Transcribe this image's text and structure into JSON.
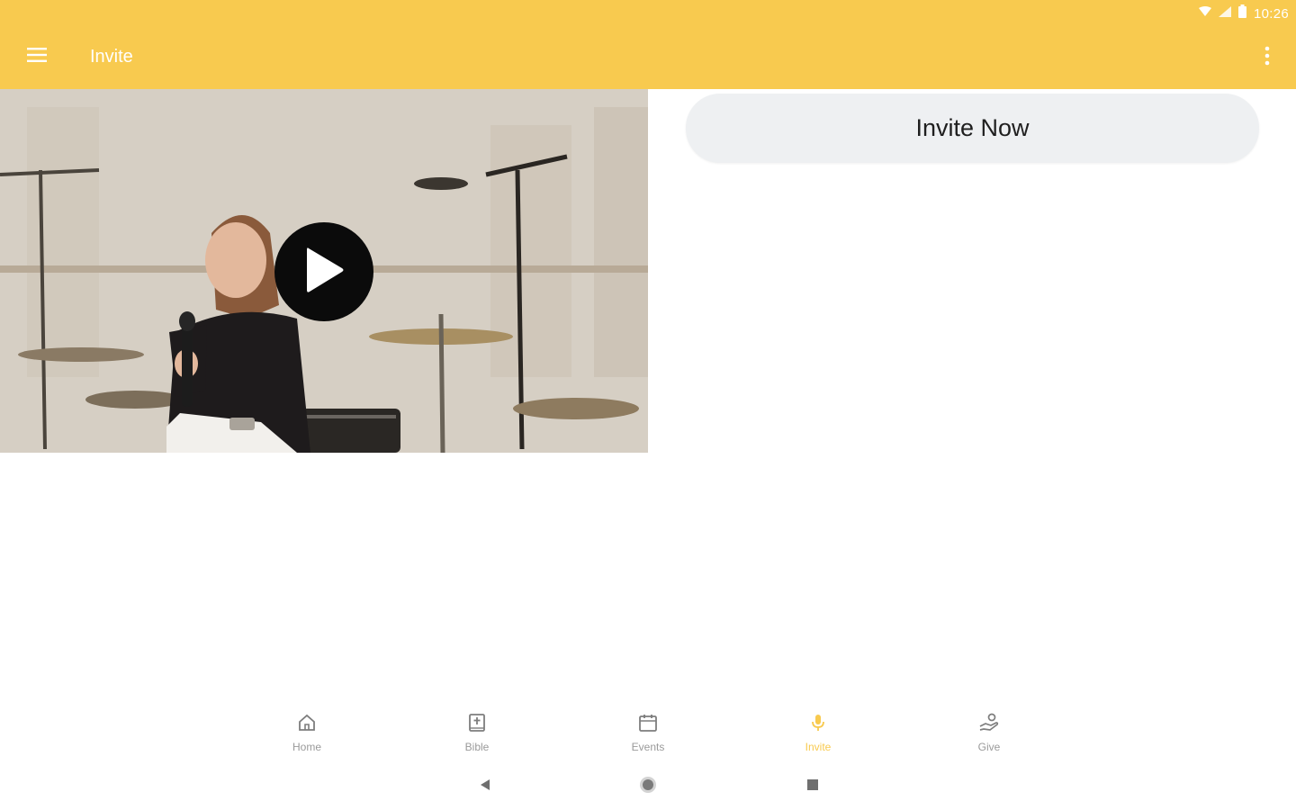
{
  "status_bar": {
    "time": "10:26",
    "icons": [
      "wifi-icon",
      "signal-icon",
      "battery-icon"
    ]
  },
  "app_bar": {
    "title": "Invite",
    "menu_icon": "hamburger-menu-icon",
    "overflow_icon": "more-vert-icon",
    "color": "#f8ca4f"
  },
  "video": {
    "play_icon": "play-icon"
  },
  "invite_button": {
    "label": "Invite Now"
  },
  "bottom_nav": {
    "active_color": "#f8ca4f",
    "inactive_color": "#9a9a9a",
    "items": [
      {
        "label": "Home",
        "icon": "home-icon",
        "active": false
      },
      {
        "label": "Bible",
        "icon": "bible-icon",
        "active": false
      },
      {
        "label": "Events",
        "icon": "calendar-icon",
        "active": false
      },
      {
        "label": "Invite",
        "icon": "microphone-icon",
        "active": true
      },
      {
        "label": "Give",
        "icon": "give-hand-icon",
        "active": false
      }
    ]
  },
  "system_nav": {
    "buttons": [
      "back-icon",
      "home-circle-icon",
      "recents-square-icon"
    ]
  }
}
